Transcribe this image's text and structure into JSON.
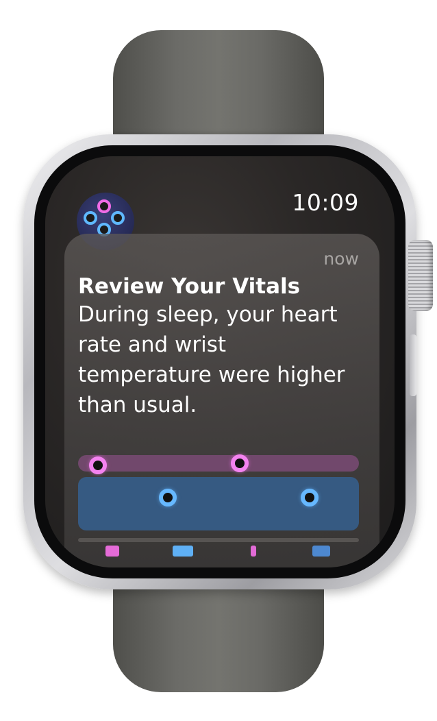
{
  "status_bar": {
    "time": "10:09"
  },
  "app": {
    "icon": "vitals-app-icon",
    "accent_pink": "#f06ce6",
    "accent_blue": "#5fb8ff"
  },
  "notification": {
    "timestamp": "now",
    "title": "Review Your Vitals",
    "body": "During sleep, your heart rate and wrist temperature were higher than usual."
  },
  "vitals_chart": {
    "pink_track_color": "#71486c",
    "blue_track_color": "#365a82"
  },
  "bottom_icons": [
    "heart-icon",
    "lungs-icon",
    "thermometer-icon",
    "sleep-icon"
  ]
}
